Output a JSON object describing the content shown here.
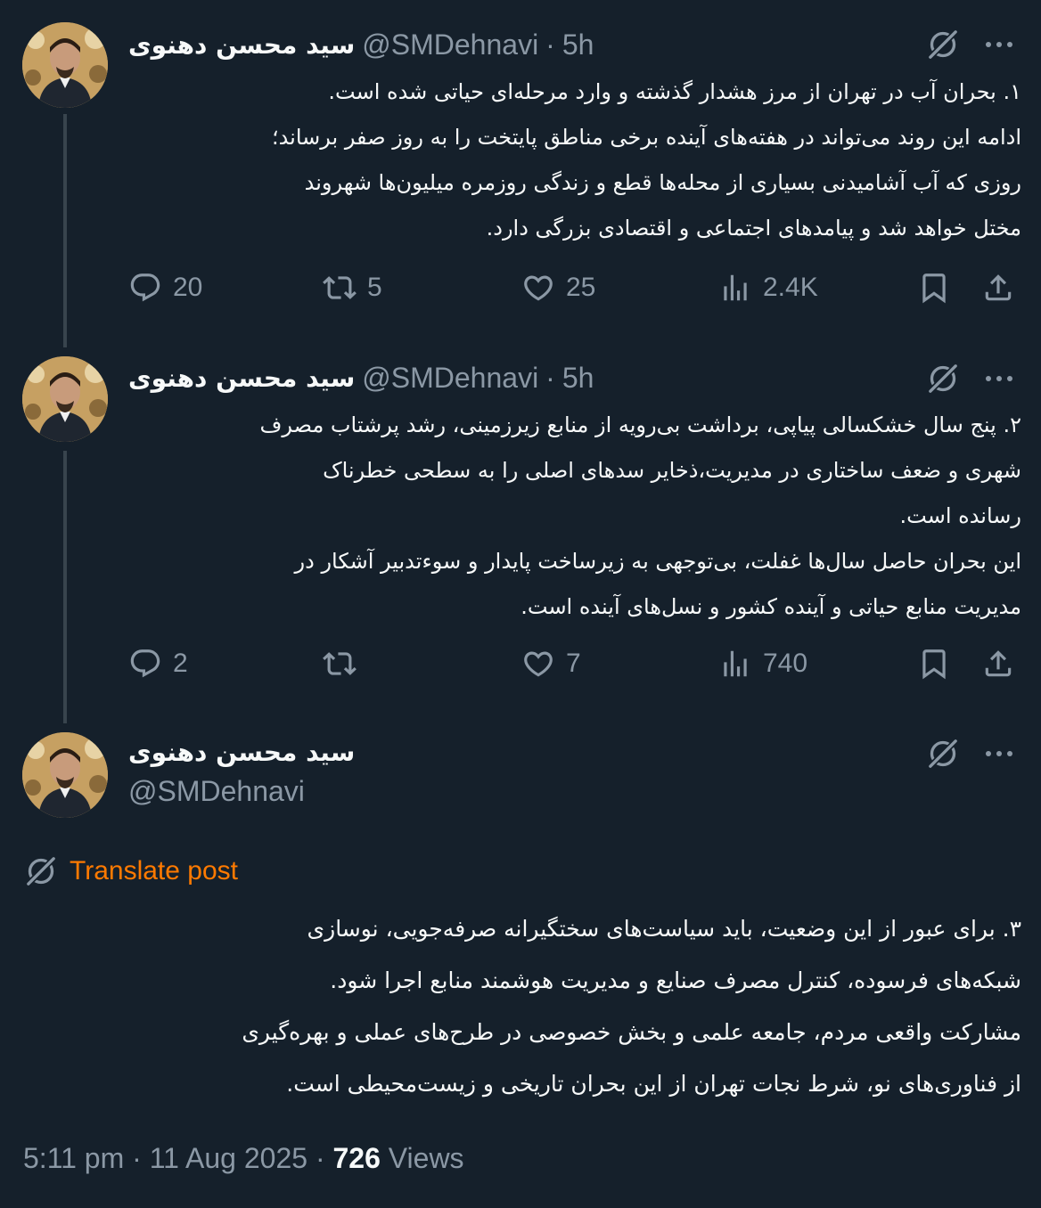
{
  "tweets": [
    {
      "name": "سید محسن دهنوی",
      "handle": "@SMDehnavi",
      "separator": "·",
      "time": "5h",
      "text": "۱. بحران آب در تهران از مرز هشدار گذشته و وارد مرحله‌ای حیاتی شده است.\nادامه این روند می‌تواند در هفته‌های آینده برخی مناطق پایتخت را به روز صفر برساند؛\nروزی که آب آشامیدنی بسیاری از محله‌ها قطع و زندگی روزمره میلیون‌ها شهروند\nمختل خواهد شد و پیامدهای اجتماعی و اقتصادی بزرگی دارد.",
      "replies": "20",
      "reposts": "5",
      "likes": "25",
      "views": "2.4K"
    },
    {
      "name": "سید محسن دهنوی",
      "handle": "@SMDehnavi",
      "separator": "·",
      "time": "5h",
      "text": "۲. پنج سال خشکسالی پیاپی، برداشت بی‌رویه از منابع زیرزمینی، رشد پرشتاب مصرف\nشهری و ضعف ساختاری در مدیریت،ذخایر سدهای اصلی را به سطحی خطرناک\nرسانده است.\nاین بحران حاصل سال‌ها غفلت، بی‌توجهی به زیرساخت پایدار و سوءتدبیر آشکار در\nمدیریت منابع حیاتی و آینده کشور و نسل‌های آینده است.",
      "replies": "2",
      "reposts": "",
      "likes": "7",
      "views": "740"
    }
  ],
  "main_tweet": {
    "name": "سید محسن دهنوی",
    "handle": "@SMDehnavi",
    "translate_label": "Translate post",
    "text": "۳. برای عبور از این وضعیت، باید سیاست‌های سختگیرانه صرفه‌جویی، نوسازی\nشبکه‌های فرسوده، کنترل مصرف صنایع و مدیریت هوشمند منابع اجرا شود.\nمشارکت واقعی مردم، جامعه علمی و بخش خصوصی در طرح‌های عملی و بهره‌گیری\nاز فناوری‌های نو، شرط نجات تهران از این بحران تاریخی و زیست‌محیطی است.",
    "timestamp": "5:11 pm · 11 Aug 2025 · ",
    "views_count": "726",
    "views_label": " Views"
  },
  "icons": {
    "reply": "reply-icon",
    "repost": "repost-icon",
    "like": "like-icon",
    "views": "views-icon",
    "bookmark": "bookmark-icon",
    "share": "share-icon",
    "grok": "grok-icon",
    "more": "more-icon",
    "translate": "translate-icon"
  },
  "colors": {
    "background": "#15202b",
    "text": "#f7f9f9",
    "secondary": "#8b98a5",
    "translate": "#ff7a00",
    "thread_line": "#38444d"
  }
}
